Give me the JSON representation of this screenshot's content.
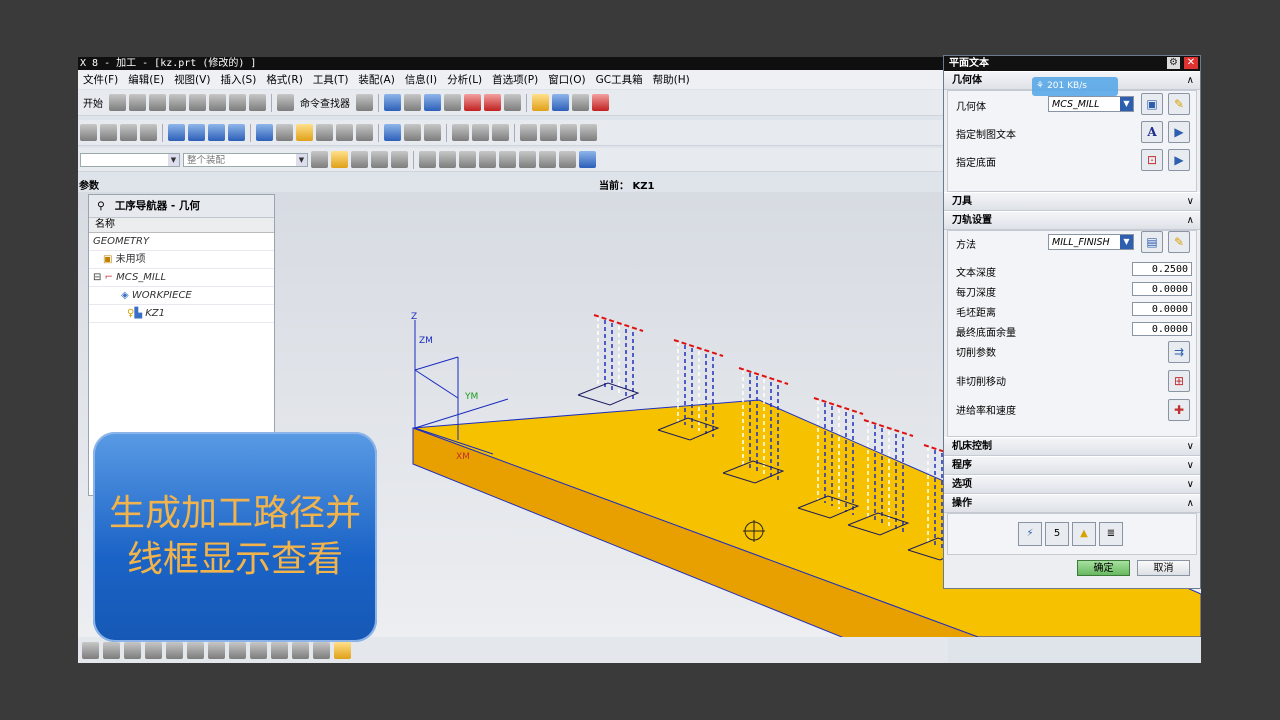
{
  "window": {
    "title": "X 8 - 加工 - [kz.prt (修改的) ]"
  },
  "menu": [
    "文件(F)",
    "编辑(E)",
    "视图(V)",
    "插入(S)",
    "格式(R)",
    "工具(T)",
    "装配(A)",
    "信息(I)",
    "分析(L)",
    "首选项(P)",
    "窗口(O)",
    "GC工具箱",
    "帮助(H)"
  ],
  "toolbar": {
    "start_label": "开始",
    "finder_label": "命令查找器",
    "assembly_placeholder": "整个装配"
  },
  "param_bar": {
    "left": "参数",
    "current": "当前： KZ1"
  },
  "navigator": {
    "title": "工序导航器 - 几何",
    "column_name": "名称",
    "rows": [
      "GEOMETRY",
      "未用项",
      "MCS_MILL",
      "WORKPIECE",
      "KZ1"
    ]
  },
  "axes": {
    "z": "Z",
    "zm": "ZM",
    "ym": "YM",
    "xm": "XM"
  },
  "overlay": {
    "text": "生成加工路径并线框显示查看"
  },
  "network": {
    "speed": "201 KB/s"
  },
  "dialog": {
    "title": "平面文本",
    "geometry": {
      "header": "几何体",
      "geometry_label": "几何体",
      "geometry_value": "MCS_MILL",
      "drawing_text_label": "指定制图文本",
      "floor_label": "指定底面"
    },
    "tool": {
      "header": "刀具"
    },
    "path": {
      "header": "刀轨设置",
      "method_label": "方法",
      "method_value": "MILL_FINISH",
      "text_depth_label": "文本深度",
      "text_depth": "0.2500",
      "step_depth_label": "每刀深度",
      "step_depth": "0.0000",
      "blank_dist_label": "毛坯距离",
      "blank_dist": "0.0000",
      "floor_stock_label": "最终底面余量",
      "floor_stock": "0.0000",
      "cut_params_label": "切削参数",
      "noncut_label": "非切削移动",
      "feeds_label": "进给率和速度"
    },
    "machine": {
      "header": "机床控制"
    },
    "program": {
      "header": "程序"
    },
    "options": {
      "header": "选项"
    },
    "actions": {
      "header": "操作"
    },
    "ok": "确定",
    "cancel": "取消"
  },
  "colors": {
    "part_top": "#f6c200",
    "part_side": "#e8a000",
    "toolpath_blue": "#2030c0",
    "toolpath_red": "#e01010",
    "overlay": "#1a63c6"
  }
}
